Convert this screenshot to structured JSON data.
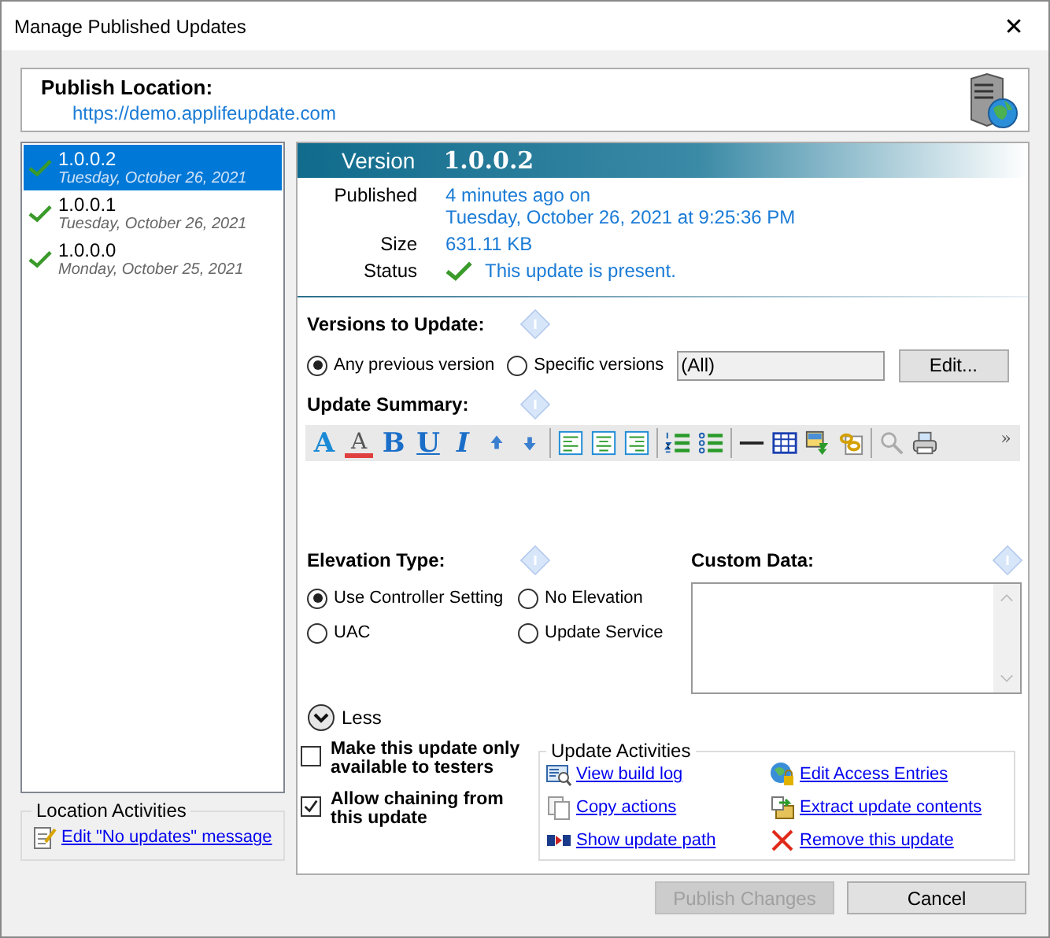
{
  "window": {
    "title": "Manage Published Updates",
    "close": "✕"
  },
  "publish_location": {
    "label": "Publish Location:",
    "url": "https://demo.applifeupdate.com"
  },
  "versions": [
    {
      "version": "1.0.0.2",
      "date": "Tuesday, October 26, 2021",
      "selected": true
    },
    {
      "version": "1.0.0.1",
      "date": "Tuesday, October 26, 2021",
      "selected": false
    },
    {
      "version": "1.0.0.0",
      "date": "Monday, October 25, 2021",
      "selected": false
    }
  ],
  "location_activities": {
    "title": "Location Activities",
    "link": "Edit \"No updates\" message"
  },
  "details": {
    "header_label": "Version",
    "header_version": "1.0.0.2",
    "rows": [
      {
        "label": "Published",
        "value": "4 minutes ago on",
        "value_2": "Tuesday, October 26, 2021 at 9:25:36 PM"
      },
      {
        "label": "Size",
        "value": "631.11 KB"
      },
      {
        "label": "Status",
        "value": "This update is present.",
        "present": true
      }
    ]
  },
  "versions_to_update": {
    "label": "Versions to Update:",
    "options": [
      {
        "label": "Any previous version",
        "selected": true
      },
      {
        "label": "Specific versions",
        "selected": false
      }
    ],
    "value": "(All)",
    "button": "Edit..."
  },
  "update_summary": {
    "label": "Update Summary:",
    "toolbar": [
      {
        "kind": "glyph",
        "text": "A"
      },
      {
        "kind": "glyph",
        "text": "A"
      },
      {
        "kind": "glyph",
        "text": "B"
      },
      {
        "kind": "glyph",
        "text": "U"
      },
      {
        "kind": "glyph",
        "text": "I"
      },
      {
        "kind": "up"
      },
      {
        "kind": "down"
      },
      {
        "kind": "separator"
      },
      {
        "kind": "align-left"
      },
      {
        "kind": "align-center"
      },
      {
        "kind": "align-right"
      },
      {
        "kind": "separator"
      },
      {
        "kind": "numbered-list"
      },
      {
        "kind": "bullet-list"
      },
      {
        "kind": "separator"
      },
      {
        "kind": "rule"
      },
      {
        "kind": "table"
      },
      {
        "kind": "image"
      },
      {
        "kind": "link"
      },
      {
        "kind": "separator"
      },
      {
        "kind": "search"
      },
      {
        "kind": "print"
      },
      {
        "kind": "glyph",
        "text": "»"
      }
    ]
  },
  "elevation_type": {
    "label": "Elevation Type:",
    "options": [
      {
        "label": "Use Controller Setting",
        "selected": true
      },
      {
        "label": "No Elevation",
        "selected": false
      },
      {
        "label": "UAC",
        "selected": false
      },
      {
        "label": "Update Service",
        "selected": false
      }
    ]
  },
  "custom_data": {
    "label": "Custom Data:"
  },
  "less_toggle": {
    "label": "Less",
    "expanded": true
  },
  "options": [
    {
      "label": "Make this update only available to testers",
      "checked": false
    },
    {
      "label": "Allow chaining from this update",
      "checked": true
    }
  ],
  "update_activities": {
    "title": "Update Activities",
    "links": [
      {
        "kind": "log",
        "label": "View build log"
      },
      {
        "kind": "access",
        "label": "Edit Access Entries"
      },
      {
        "kind": "copy",
        "label": "Copy actions"
      },
      {
        "kind": "extract",
        "label": "Extract update contents"
      },
      {
        "kind": "path",
        "label": "Show update path"
      },
      {
        "kind": "remove",
        "label": "Remove this update"
      }
    ]
  },
  "buttons": [
    {
      "label": "Publish Changes",
      "disabled": true
    },
    {
      "label": "Cancel",
      "disabled": false
    }
  ]
}
